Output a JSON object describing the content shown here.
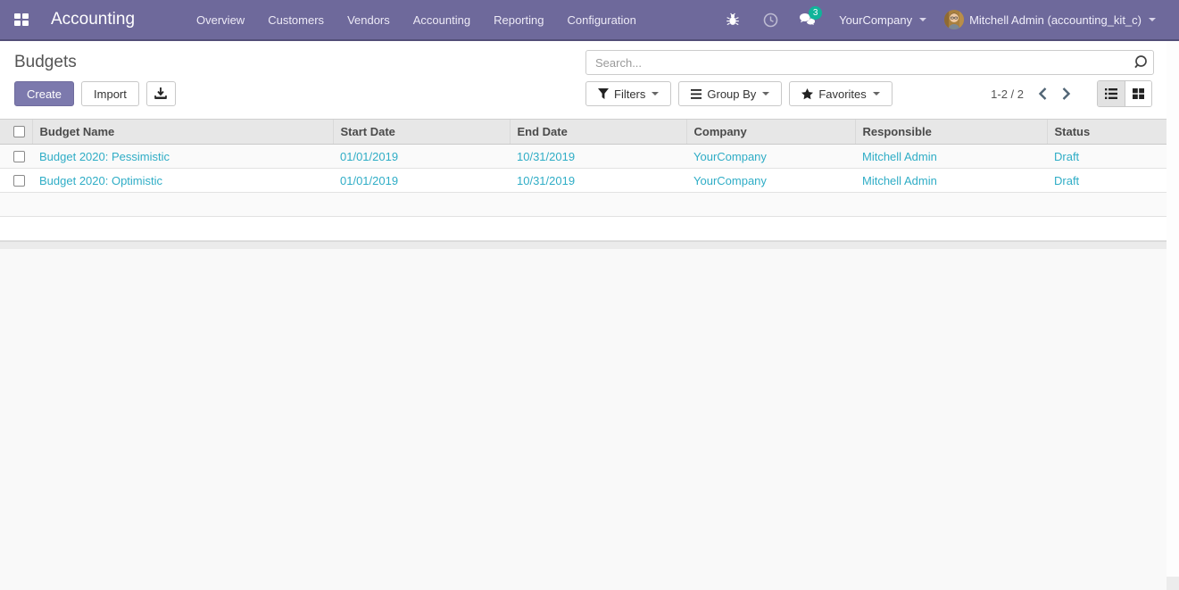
{
  "navbar": {
    "app_title": "Accounting",
    "menu": [
      "Overview",
      "Customers",
      "Vendors",
      "Accounting",
      "Reporting",
      "Configuration"
    ],
    "systray": {
      "messages_badge": "3",
      "company_menu": "YourCompany",
      "user_menu": "Mitchell Admin (accounting_kit_c)"
    }
  },
  "page": {
    "title": "Budgets"
  },
  "actions": {
    "create": "Create",
    "import": "Import"
  },
  "search": {
    "placeholder": "Search..."
  },
  "filter_bar": {
    "filters": "Filters",
    "group_by": "Group By",
    "favorites": "Favorites"
  },
  "pager": {
    "range": "1-2 / 2"
  },
  "view_switcher": {
    "active_view": "list",
    "views": [
      "list",
      "kanban"
    ]
  },
  "table": {
    "columns": [
      "Budget Name",
      "Start Date",
      "End Date",
      "Company",
      "Responsible",
      "Status"
    ],
    "rows": [
      {
        "name": "Budget 2020: Pessimistic",
        "start_date": "01/01/2019",
        "end_date": "10/31/2019",
        "company": "YourCompany",
        "responsible": "Mitchell Admin",
        "status": "Draft"
      },
      {
        "name": "Budget 2020: Optimistic",
        "start_date": "01/01/2019",
        "end_date": "10/31/2019",
        "company": "YourCompany",
        "responsible": "Mitchell Admin",
        "status": "Draft"
      }
    ]
  },
  "icons": {
    "apps": "grid-2x2",
    "debug": "bug",
    "activities": "clock",
    "messages": "speech-bubbles",
    "search": "magnifier",
    "filters": "funnel",
    "group_by": "bars",
    "favorites": "star",
    "export": "download-tray",
    "prev": "chevron-left",
    "next": "chevron-right",
    "list_view": "list-bullets",
    "kanban_view": "grid-large"
  },
  "colors": {
    "navbar_bg": "#6e699b",
    "accent": "#7c79ad",
    "link": "#2fadc6",
    "badge_bg": "#10b49a",
    "header_bg": "#e7e7e7"
  }
}
